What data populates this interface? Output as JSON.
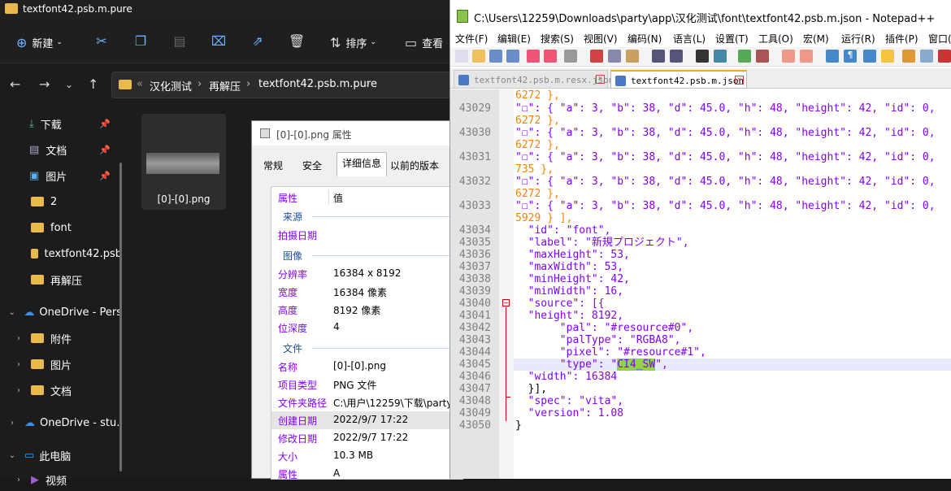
{
  "explorer": {
    "title": "textfont42.psb.m.pure",
    "toolbar": {
      "new_label": "新建",
      "sort_label": "排序",
      "view_label": "查看"
    },
    "breadcrumb": [
      "汉化测试",
      "再解压",
      "textfont42.psb.m.pure"
    ],
    "sidebar": [
      {
        "label": "下载",
        "pinned": true,
        "icon": "download-icon"
      },
      {
        "label": "文档",
        "pinned": true,
        "icon": "document-icon"
      },
      {
        "label": "图片",
        "pinned": true,
        "icon": "picture-icon"
      },
      {
        "label": "2",
        "icon": "folder-icon"
      },
      {
        "label": "font",
        "icon": "folder-icon"
      },
      {
        "label": "textfont42.psb",
        "icon": "folder-icon"
      },
      {
        "label": "再解压",
        "icon": "folder-icon"
      },
      {
        "label": "OneDrive - Pers",
        "icon": "onedrive-icon"
      },
      {
        "label": "附件",
        "icon": "folder-icon"
      },
      {
        "label": "图片",
        "icon": "folder-icon"
      },
      {
        "label": "文档",
        "icon": "folder-icon"
      },
      {
        "label": "OneDrive - stu.",
        "icon": "onedrive-icon"
      },
      {
        "label": "此电脑",
        "icon": "pc-icon"
      },
      {
        "label": "视频",
        "icon": "video-icon"
      }
    ],
    "file_label": "[0]-[0].png"
  },
  "props": {
    "title": "[0]-[0].png 属性",
    "tabs": [
      "常规",
      "安全",
      "详细信息",
      "以前的版本"
    ],
    "header_key": "属性",
    "header_val": "值",
    "sec_source": "来源",
    "sec_image": "图像",
    "sec_file": "文件",
    "rows": [
      {
        "k": "拍摄日期",
        "v": ""
      },
      {
        "k": "分辨率",
        "v": "16384 x 8192"
      },
      {
        "k": "宽度",
        "v": "16384 像素"
      },
      {
        "k": "高度",
        "v": "8192 像素"
      },
      {
        "k": "位深度",
        "v": "4"
      },
      {
        "k": "名称",
        "v": "[0]-[0].png"
      },
      {
        "k": "项目类型",
        "v": "PNG 文件"
      },
      {
        "k": "文件夹路径",
        "v": "C:\\用户\\12259\\下载\\party"
      },
      {
        "k": "创建日期",
        "v": "2022/9/7 17:22"
      },
      {
        "k": "修改日期",
        "v": "2022/9/7 17:22"
      },
      {
        "k": "大小",
        "v": "10.3 MB"
      },
      {
        "k": "属性",
        "v": "A"
      }
    ]
  },
  "npp": {
    "title": "C:\\Users\\12259\\Downloads\\party\\app\\汉化测试\\font\\textfont42.psb.m.json - Notepad++",
    "menu": [
      "文件(F)",
      "编辑(E)",
      "搜索(S)",
      "视图(V)",
      "编码(N)",
      "语言(L)",
      "设置(T)",
      "工具(O)",
      "宏(M)",
      "运行(R)",
      "插件(P)",
      "窗口("
    ],
    "tabs": [
      {
        "label": "textfont42.psb.m.resx.json",
        "active": false
      },
      {
        "label": "textfont42.psb.m.json",
        "active": true
      }
    ],
    "line_numbers": [
      "43029",
      "43030",
      "43031",
      "43032",
      "43033",
      "43034",
      "43035",
      "43036",
      "43037",
      "43038",
      "43039",
      "43040",
      "43041",
      "43042",
      "43043",
      "43044",
      "43045",
      "43046",
      "43047",
      "43048",
      "43049",
      "43050"
    ],
    "wrap_tails": [
      "6272 },",
      "6272 },",
      "6272 },",
      "735 },",
      "6272 },",
      "5929 } ],"
    ],
    "code_lines": {
      "glyph_entry": "\"☐\": { \"a\": 3, \"b\": 38, \"d\": 45.0, \"h\": 48, \"height\": 42, \"id\": 0,",
      "l43034": "  \"id\": \"font\",",
      "l43035": "  \"label\": \"新規プロジェクト\",",
      "l43036": "  \"maxHeight\": 53,",
      "l43037": "  \"maxWidth\": 53,",
      "l43038": "  \"minHeight\": 42,",
      "l43039": "  \"minWidth\": 16,",
      "l43040": "  \"source\": [{",
      "l43041": "  \"height\": 8192,",
      "l43042": "       \"pal\": \"#resource#0\",",
      "l43043": "       \"palType\": \"RGBA8\",",
      "l43044": "       \"pixel\": \"#resource#1\",",
      "l43045_pre": "       \"type\": \"",
      "l43045_sel": "CI4_SW",
      "l43045_post": "\",",
      "l43046": "  \"width\": 16384",
      "l43047": "  }],",
      "l43048": "  \"spec\": \"vita\",",
      "l43049": "  \"version\": 1.08",
      "l43050": "}"
    }
  }
}
